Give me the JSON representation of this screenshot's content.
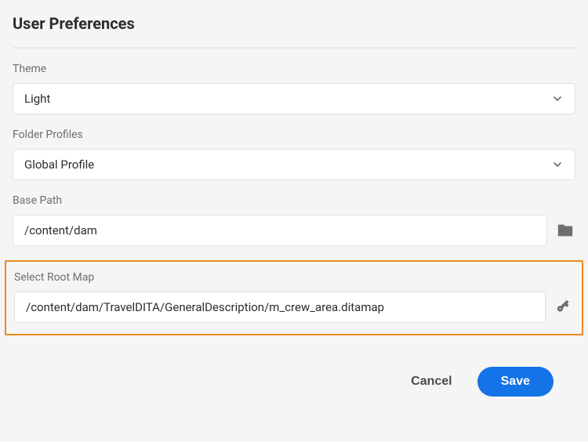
{
  "title": "User Preferences",
  "theme": {
    "label": "Theme",
    "value": "Light"
  },
  "folderProfiles": {
    "label": "Folder Profiles",
    "value": "Global Profile"
  },
  "basePath": {
    "label": "Base Path",
    "value": "/content/dam"
  },
  "rootMap": {
    "label": "Select Root Map",
    "value": "/content/dam/TravelDITA/GeneralDescription/m_crew_area.ditamap"
  },
  "actions": {
    "cancel": "Cancel",
    "save": "Save"
  }
}
